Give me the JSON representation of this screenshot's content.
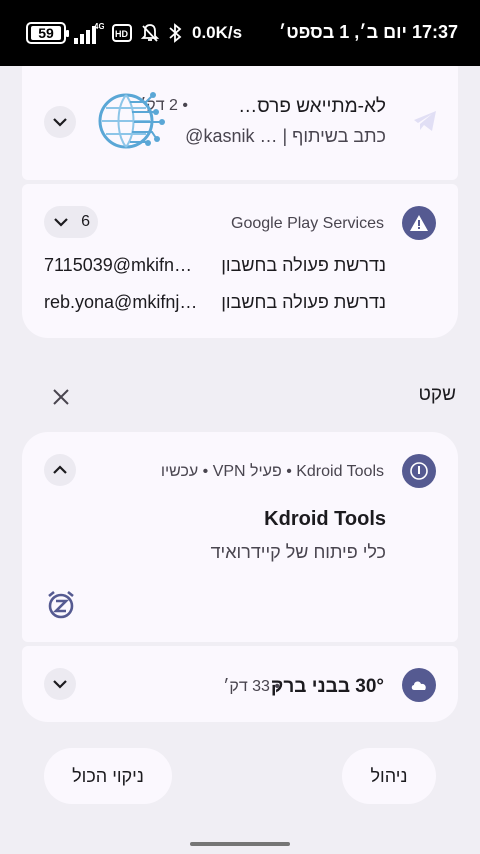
{
  "status_bar": {
    "battery": "59",
    "network": "4G",
    "hd_label": "HD",
    "speed": "0.0K/s",
    "datetime": "17:37 יום ב׳, 1 בספט׳"
  },
  "notifications": {
    "first": {
      "title": "לא-מתייאש פרס…",
      "time": "2 דק׳",
      "text": "כתב בשיתוף | … kasnik@"
    },
    "google_play": {
      "app": "Google Play Services",
      "count": "6",
      "items": [
        {
          "text": "נדרשת פעולה בחשבון",
          "account": "7115039@mkifn…"
        },
        {
          "text": "נדרשת פעולה בחשבון",
          "account": "reb.yona@mkifnj…"
        }
      ]
    },
    "silent_section": {
      "label": "שקט"
    },
    "kdroid": {
      "header": "Kdroid Tools • פעיל VPN • עכשיו",
      "title": "Kdroid Tools",
      "text": "כלי פיתוח של קיידרואיד"
    },
    "weather": {
      "text": "30° בבני ברק",
      "time": "33 דק׳"
    }
  },
  "actions": {
    "manage": "ניהול",
    "clear_all": "ניקוי הכול"
  },
  "colors": {
    "accent": "#555a91",
    "card": "#fbf8fe",
    "background": "#f0eef4"
  }
}
